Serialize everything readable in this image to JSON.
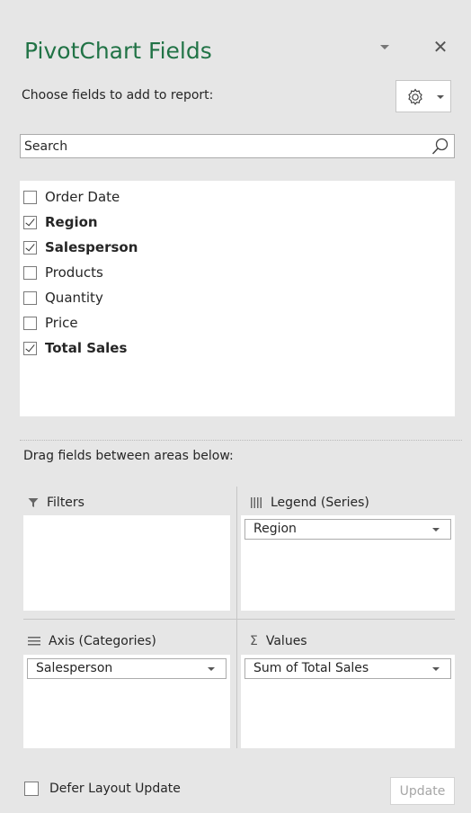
{
  "pane": {
    "title": "PivotChart Fields",
    "close_glyph": "✕",
    "choose_label": "Choose fields to add to report:",
    "tools_icon": "gear-icon",
    "accent_color": "#217346"
  },
  "search": {
    "placeholder": "Search",
    "value": ""
  },
  "fields": [
    {
      "label": "Order Date",
      "checked": false
    },
    {
      "label": "Region",
      "checked": true
    },
    {
      "label": "Salesperson",
      "checked": true
    },
    {
      "label": "Products",
      "checked": false
    },
    {
      "label": "Quantity",
      "checked": false
    },
    {
      "label": "Price",
      "checked": false
    },
    {
      "label": "Total Sales",
      "checked": true
    }
  ],
  "areas": {
    "drag_label": "Drag fields between areas below:",
    "filters": {
      "label": "Filters",
      "icon": "filter-icon"
    },
    "legend": {
      "label": "Legend (Series)",
      "icon": "columns-icon",
      "item": "Region"
    },
    "axis": {
      "label": "Axis (Categories)",
      "icon": "rows-icon",
      "item": "Salesperson"
    },
    "values": {
      "label": "Values",
      "icon": "sigma-icon",
      "glyph": "Σ",
      "item": "Sum of Total Sales"
    }
  },
  "footer": {
    "defer_label": "Defer Layout Update",
    "defer_checked": false,
    "update_label": "Update"
  }
}
